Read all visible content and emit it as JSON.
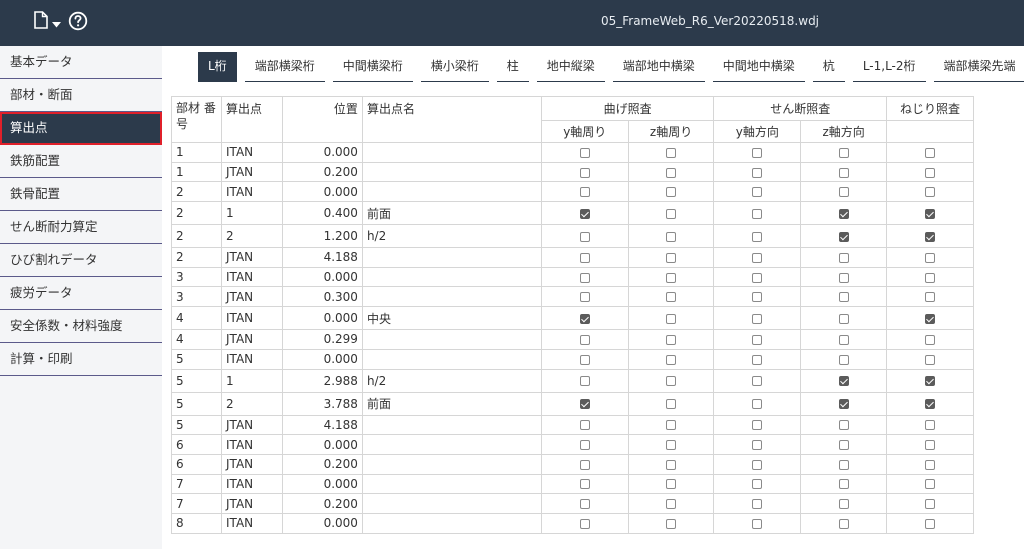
{
  "header": {
    "title": "05_FrameWeb_R6_Ver20220518.wdj",
    "file_icon": "file-icon",
    "help_icon": "help-icon"
  },
  "sidebar": {
    "items": [
      {
        "label": "基本データ",
        "active": false
      },
      {
        "label": "部材・断面",
        "active": false
      },
      {
        "label": "算出点",
        "active": true
      },
      {
        "label": "鉄筋配置",
        "active": false
      },
      {
        "label": "鉄骨配置",
        "active": false
      },
      {
        "label": "せん断耐力算定",
        "active": false
      },
      {
        "label": "ひび割れデータ",
        "active": false
      },
      {
        "label": "疲労データ",
        "active": false
      },
      {
        "label": "安全係数・材料強度",
        "active": false
      },
      {
        "label": "計算・印刷",
        "active": false
      }
    ]
  },
  "tabs": [
    {
      "label": "L桁",
      "active": true
    },
    {
      "label": "端部横梁桁",
      "active": false
    },
    {
      "label": "中間横梁桁",
      "active": false
    },
    {
      "label": "横小梁桁",
      "active": false
    },
    {
      "label": "柱",
      "active": false
    },
    {
      "label": "地中縦梁",
      "active": false
    },
    {
      "label": "端部地中横梁",
      "active": false
    },
    {
      "label": "中間地中横梁",
      "active": false
    },
    {
      "label": "杭",
      "active": false
    },
    {
      "label": "L-1,L-2桁",
      "active": false
    },
    {
      "label": "端部横梁先端",
      "active": false
    }
  ],
  "table": {
    "headers": {
      "member_no": "部材 番号",
      "calc_point": "算出点",
      "position": "位置",
      "point_name": "算出点名",
      "bending": "曲げ照査",
      "shear": "せん断照査",
      "torsion": "ねじり照査",
      "y_around": "y軸周り",
      "z_around": "z軸周り",
      "y_dir": "y軸方向",
      "z_dir": "z軸方向"
    },
    "rows": [
      {
        "no": "1",
        "pt": "ITAN",
        "pos": "0.000",
        "name": "",
        "c": [
          false,
          false,
          false,
          false,
          false
        ]
      },
      {
        "no": "1",
        "pt": "JTAN",
        "pos": "0.200",
        "name": "",
        "c": [
          false,
          false,
          false,
          false,
          false
        ]
      },
      {
        "no": "2",
        "pt": "ITAN",
        "pos": "0.000",
        "name": "",
        "c": [
          false,
          false,
          false,
          false,
          false
        ]
      },
      {
        "no": "2",
        "pt": "1",
        "pos": "0.400",
        "name": "前面",
        "c": [
          true,
          false,
          false,
          true,
          true
        ]
      },
      {
        "no": "2",
        "pt": "2",
        "pos": "1.200",
        "name": "h/2",
        "c": [
          false,
          false,
          false,
          true,
          true
        ]
      },
      {
        "no": "2",
        "pt": "JTAN",
        "pos": "4.188",
        "name": "",
        "c": [
          false,
          false,
          false,
          false,
          false
        ]
      },
      {
        "no": "3",
        "pt": "ITAN",
        "pos": "0.000",
        "name": "",
        "c": [
          false,
          false,
          false,
          false,
          false
        ]
      },
      {
        "no": "3",
        "pt": "JTAN",
        "pos": "0.300",
        "name": "",
        "c": [
          false,
          false,
          false,
          false,
          false
        ]
      },
      {
        "no": "4",
        "pt": "ITAN",
        "pos": "0.000",
        "name": "中央",
        "c": [
          true,
          false,
          false,
          false,
          true
        ]
      },
      {
        "no": "4",
        "pt": "JTAN",
        "pos": "0.299",
        "name": "",
        "c": [
          false,
          false,
          false,
          false,
          false
        ]
      },
      {
        "no": "5",
        "pt": "ITAN",
        "pos": "0.000",
        "name": "",
        "c": [
          false,
          false,
          false,
          false,
          false
        ]
      },
      {
        "no": "5",
        "pt": "1",
        "pos": "2.988",
        "name": "h/2",
        "c": [
          false,
          false,
          false,
          true,
          true
        ]
      },
      {
        "no": "5",
        "pt": "2",
        "pos": "3.788",
        "name": "前面",
        "c": [
          true,
          false,
          false,
          true,
          true
        ]
      },
      {
        "no": "5",
        "pt": "JTAN",
        "pos": "4.188",
        "name": "",
        "c": [
          false,
          false,
          false,
          false,
          false
        ]
      },
      {
        "no": "6",
        "pt": "ITAN",
        "pos": "0.000",
        "name": "",
        "c": [
          false,
          false,
          false,
          false,
          false
        ]
      },
      {
        "no": "6",
        "pt": "JTAN",
        "pos": "0.200",
        "name": "",
        "c": [
          false,
          false,
          false,
          false,
          false
        ]
      },
      {
        "no": "7",
        "pt": "ITAN",
        "pos": "0.000",
        "name": "",
        "c": [
          false,
          false,
          false,
          false,
          false
        ]
      },
      {
        "no": "7",
        "pt": "JTAN",
        "pos": "0.200",
        "name": "",
        "c": [
          false,
          false,
          false,
          false,
          false
        ]
      },
      {
        "no": "8",
        "pt": "ITAN",
        "pos": "0.000",
        "name": "",
        "c": [
          false,
          false,
          false,
          false,
          false
        ]
      }
    ]
  }
}
